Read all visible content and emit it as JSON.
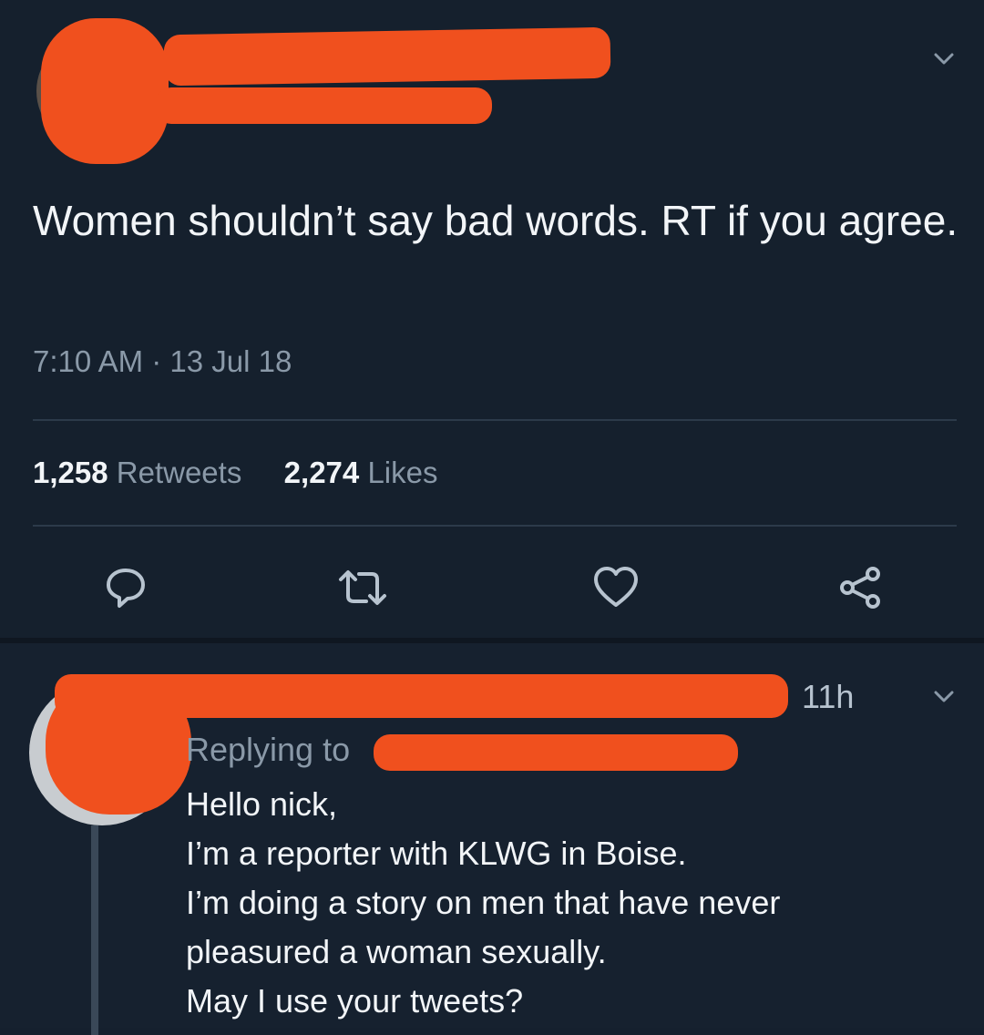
{
  "main_tweet": {
    "text": "Women shouldn’t say bad words. RT if you agree.",
    "time": "7:10 AM",
    "date_sep": " · ",
    "date": "13 Jul 18",
    "retweets_count": "1,258",
    "retweets_label": "Retweets",
    "likes_count": "2,274",
    "likes_label": "Likes"
  },
  "reply_tweet": {
    "age": "11h",
    "replying_to_label": "Replying to",
    "lines": [
      "Hello nick,",
      "I’m a reporter with KLWG in Boise.",
      "I’m doing a story on men that have never",
      "pleasured a woman sexually.",
      "May I use your tweets?"
    ]
  },
  "icons": {
    "main_menu": "chevron-down-icon",
    "reply": "reply-icon",
    "retweet": "retweet-icon",
    "like": "heart-icon",
    "share": "share-icon",
    "reply_menu": "chevron-down-icon"
  },
  "colors": {
    "background": "#15202e",
    "redaction": "#f0501e",
    "muted_text": "#8a99a8"
  }
}
